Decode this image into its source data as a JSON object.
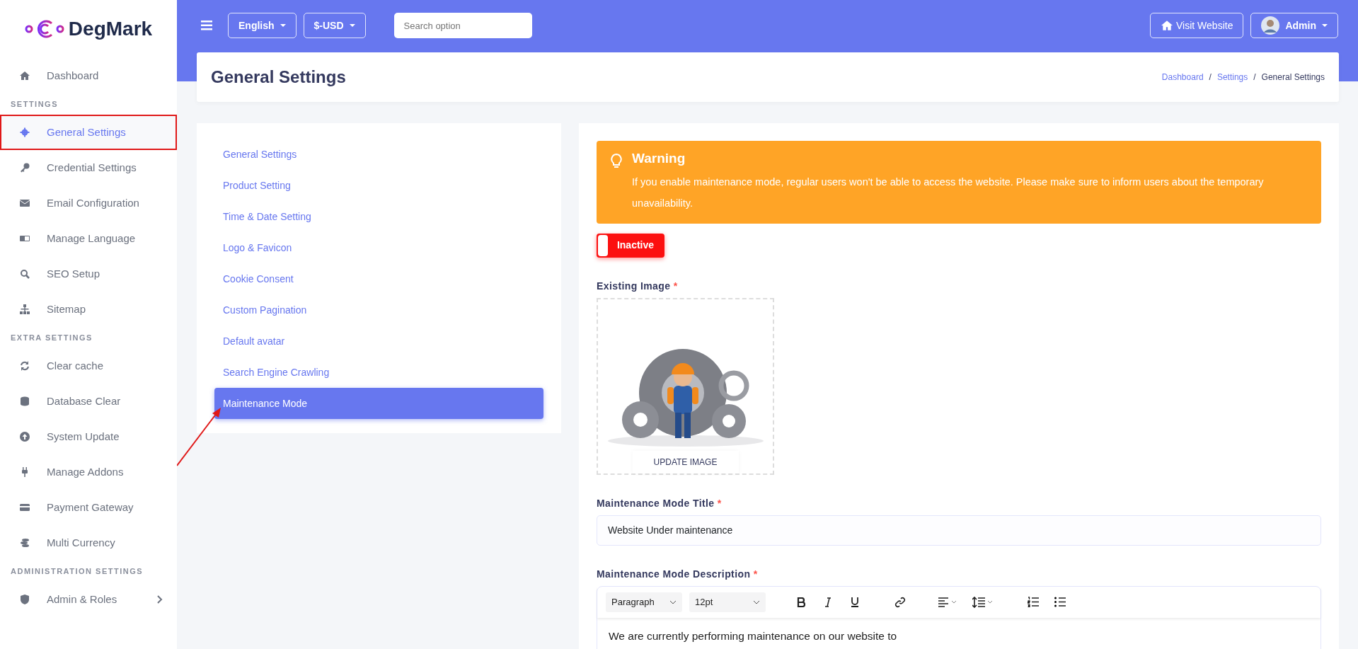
{
  "brand": {
    "name": "DegMark"
  },
  "sidebar": {
    "sections": [
      {
        "items": [
          {
            "label": "Dashboard",
            "selected": false,
            "annotated": false,
            "expandable": false
          }
        ]
      },
      {
        "heading": "SETTINGS",
        "items": [
          {
            "label": "General Settings",
            "selected": true,
            "annotated": true,
            "expandable": false
          },
          {
            "label": "Credential Settings",
            "selected": false,
            "annotated": false,
            "expandable": false
          },
          {
            "label": "Email Configuration",
            "selected": false,
            "annotated": false,
            "expandable": false
          },
          {
            "label": "Manage Language",
            "selected": false,
            "annotated": false,
            "expandable": false
          },
          {
            "label": "SEO Setup",
            "selected": false,
            "annotated": false,
            "expandable": false
          },
          {
            "label": "Sitemap",
            "selected": false,
            "annotated": false,
            "expandable": false
          }
        ]
      },
      {
        "heading": "EXTRA SETTINGS",
        "items": [
          {
            "label": "Clear cache",
            "selected": false,
            "annotated": false,
            "expandable": false
          },
          {
            "label": "Database Clear",
            "selected": false,
            "annotated": false,
            "expandable": false
          },
          {
            "label": "System Update",
            "selected": false,
            "annotated": false,
            "expandable": false
          },
          {
            "label": "Manage Addons",
            "selected": false,
            "annotated": false,
            "expandable": false
          },
          {
            "label": "Payment Gateway",
            "selected": false,
            "annotated": false,
            "expandable": false
          },
          {
            "label": "Multi Currency",
            "selected": false,
            "annotated": false,
            "expandable": false
          }
        ]
      },
      {
        "heading": "ADMINISTRATION SETTINGS",
        "items": [
          {
            "label": "Admin & Roles",
            "selected": false,
            "annotated": false,
            "expandable": true
          }
        ]
      }
    ]
  },
  "topbar": {
    "language": "English",
    "currency": "$-USD",
    "search": {
      "placeholder": "Search option"
    },
    "visit_button": "Visit Website",
    "user": "Admin"
  },
  "header": {
    "title": "General Settings",
    "separator": "/",
    "breadcrumb": [
      {
        "label": "Dashboard",
        "link": true
      },
      {
        "label": "Settings",
        "link": true
      },
      {
        "label": "General Settings",
        "link": false
      }
    ]
  },
  "settings_menu": [
    {
      "label": "General Settings",
      "selected": false
    },
    {
      "label": "Product Setting",
      "selected": false
    },
    {
      "label": "Time & Date Setting",
      "selected": false
    },
    {
      "label": "Logo & Favicon",
      "selected": false
    },
    {
      "label": "Cookie Consent",
      "selected": false
    },
    {
      "label": "Custom Pagination",
      "selected": false
    },
    {
      "label": "Default avatar",
      "selected": false
    },
    {
      "label": "Search Engine Crawling",
      "selected": false
    },
    {
      "label": "Maintenance Mode",
      "selected": true
    }
  ],
  "annotation_arrow": true,
  "warning": {
    "title": "Warning",
    "text": "If you enable maintenance mode, regular users won't be able to access the website. Please make sure to inform users about the temporary unavailability."
  },
  "toggle": {
    "label": "Inactive",
    "on": false
  },
  "image_field": {
    "label": "Existing Image",
    "required_mark": "*",
    "button": "UPDATE IMAGE"
  },
  "title_field": {
    "label": "Maintenance Mode Title",
    "required_mark": "*",
    "value": "Website Under maintenance"
  },
  "description_field": {
    "label": "Maintenance Mode Description",
    "required_mark": "*",
    "block_format": "Paragraph",
    "font_size": "12pt",
    "content": "We are currently performing maintenance on our website to"
  }
}
